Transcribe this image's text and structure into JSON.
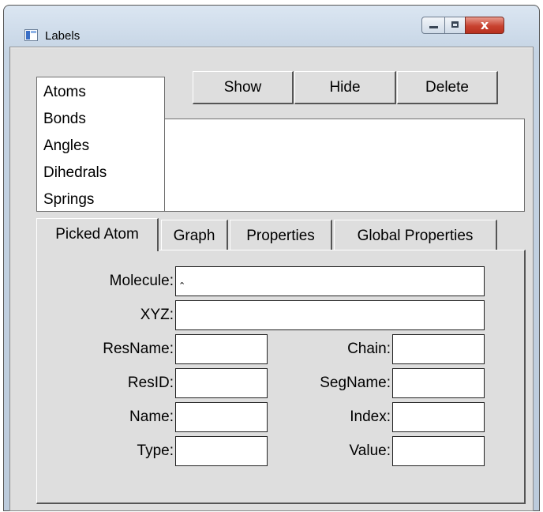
{
  "window": {
    "title": "Labels",
    "close_glyph": "x"
  },
  "type_list": {
    "items": [
      "Atoms",
      "Bonds",
      "Angles",
      "Dihedrals",
      "Springs"
    ],
    "selected": "Atoms"
  },
  "buttons": {
    "show": "Show",
    "hide": "Hide",
    "delete": "Delete"
  },
  "tabs": {
    "picked_atom": "Picked Atom",
    "graph": "Graph",
    "properties": "Properties",
    "global_properties": "Global Properties",
    "active": "Picked Atom"
  },
  "picked_atom": {
    "molecule_label": "Molecule:",
    "xyz_label": "XYZ:",
    "resname_label": "ResName:",
    "resid_label": "ResID:",
    "name_label": "Name:",
    "type_label": "Type:",
    "chain_label": "Chain:",
    "segname_label": "SegName:",
    "index_label": "Index:",
    "value_label": "Value:",
    "molecule_value": "",
    "xyz_value": "",
    "resname_value": "",
    "resid_value": "",
    "name_value": "",
    "type_value": "",
    "chain_value": "",
    "segname_value": "",
    "index_value": "",
    "value_value": ""
  }
}
